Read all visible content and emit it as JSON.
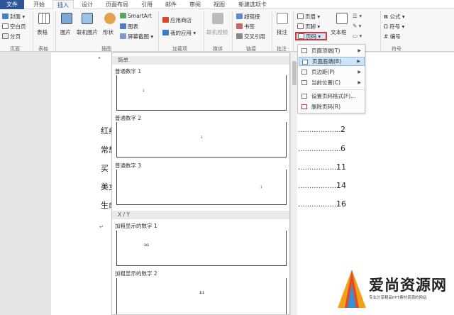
{
  "tabs": [
    {
      "label": "文件",
      "name": "tab-file"
    },
    {
      "label": "开始",
      "name": "tab-home"
    },
    {
      "label": "插入",
      "name": "tab-insert"
    },
    {
      "label": "设计",
      "name": "tab-design"
    },
    {
      "label": "页面布局",
      "name": "tab-layout"
    },
    {
      "label": "引用",
      "name": "tab-references"
    },
    {
      "label": "邮件",
      "name": "tab-mailings"
    },
    {
      "label": "审阅",
      "name": "tab-review"
    },
    {
      "label": "视图",
      "name": "tab-view"
    },
    {
      "label": "新建选项卡",
      "name": "tab-new"
    }
  ],
  "ribbon": {
    "cover": "封面",
    "blank_page": "空白页",
    "page_break": "分页",
    "group_pages": "页面",
    "table": "表格",
    "group_table": "表格",
    "picture": "图片",
    "online_picture": "联机图片",
    "shapes": "形状",
    "smartart": "SmartArt",
    "chart": "图表",
    "screenshot": "屏幕截图",
    "group_illustrations": "插图",
    "app_store": "应用商店",
    "my_apps": "我的应用",
    "group_apps": "加载项",
    "online_video": "联机视频",
    "group_media": "媒体",
    "hyperlink": "超链接",
    "bookmark": "书签",
    "cross_ref": "交叉引用",
    "group_links": "链接",
    "comment": "批注",
    "group_comments": "批注",
    "header": "页眉",
    "footer": "页脚",
    "page_number": "页码",
    "textbox": "文本框",
    "equation": "公式",
    "symbol": "符号",
    "numbering": "编号",
    "group_symbols": "符号"
  },
  "document": {
    "toc": [
      {
        "title": "红纟",
        "page": "2"
      },
      {
        "title": "常想",
        "page": "6"
      },
      {
        "title": "买｜",
        "page": "11"
      },
      {
        "title": "美女",
        "page": "14"
      },
      {
        "title": "生命",
        "page": "16"
      }
    ]
  },
  "gallery": {
    "section_simple": "简单",
    "item1": "普通数字 1",
    "item1_num": "1",
    "item2": "普通数字 2",
    "item2_num": "1",
    "item3": "普通数字 3",
    "item3_num": "1",
    "section_xy": "X / Y",
    "item4": "加粗显示的数字 1",
    "item4_num": "1/1",
    "item5": "加粗显示的数字 2",
    "item5_num": "1/1"
  },
  "menu": {
    "top": "页面顶端(T)",
    "bottom": "页面底端(B)",
    "margin": "页边距(P)",
    "current": "当前位置(C)",
    "format": "设置页码格式(F)...",
    "remove": "删除页码(R)"
  },
  "logo": {
    "title": "爱尚资源网",
    "subtitle": "专业分享精品PPT素材资源的网站"
  }
}
